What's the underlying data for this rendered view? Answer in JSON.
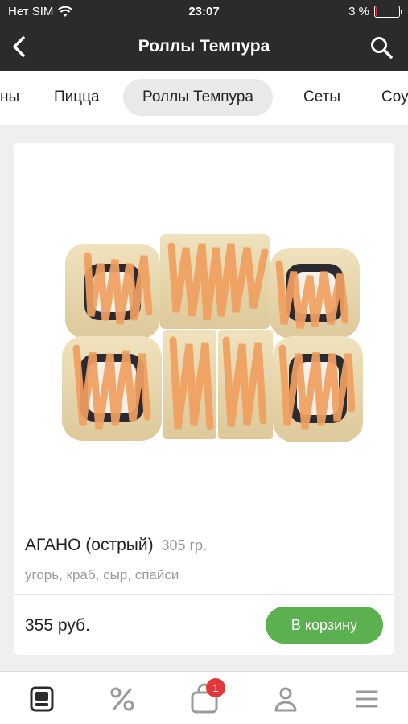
{
  "status": {
    "carrier": "Нет SIM",
    "time": "23:07",
    "battery": "3 %"
  },
  "header": {
    "title": "Роллы Темпура"
  },
  "categories": [
    {
      "label": "ны"
    },
    {
      "label": "Пицца"
    },
    {
      "label": "Роллы Темпура",
      "active": true
    },
    {
      "label": "Сеты"
    },
    {
      "label": "Соу"
    }
  ],
  "product": {
    "name": "АГАНО (острый)",
    "weight": "305 гр.",
    "description": "угорь, краб, сыр, спайси",
    "price": "355 руб.",
    "cart_label": "В корзину"
  },
  "bottom_nav": {
    "cart_count": "1"
  },
  "colors": {
    "dark": "#2b2b2b",
    "accent_green": "#5bb04f",
    "badge_red": "#e2383a"
  }
}
